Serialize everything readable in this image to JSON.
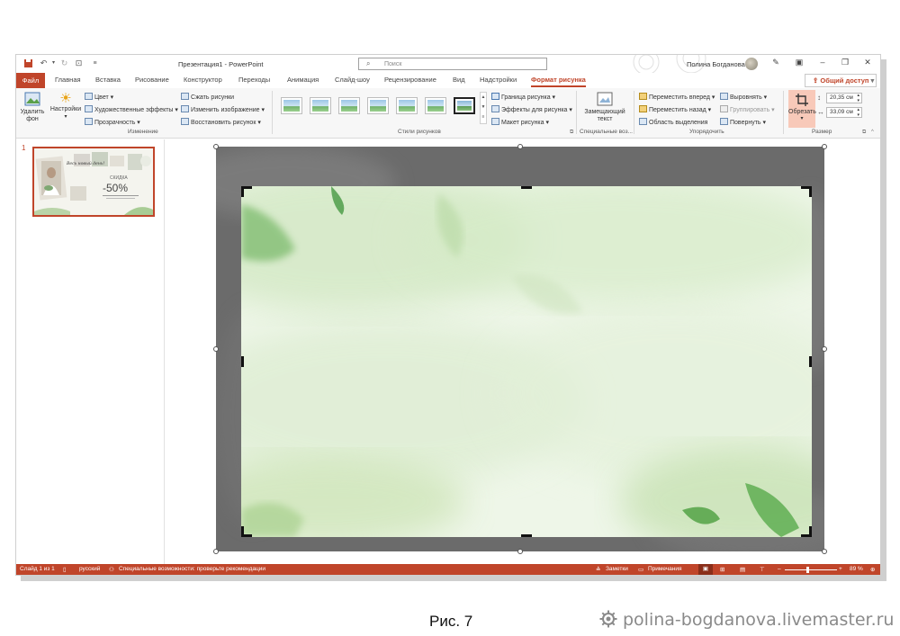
{
  "titlebar": {
    "doc_title": "Презентация1  -  PowerPoint",
    "search_placeholder": "Поиск",
    "user_name": "Полина Богданова"
  },
  "tabs": {
    "file": "Файл",
    "items": [
      "Главная",
      "Вставка",
      "Рисование",
      "Конструктор",
      "Переходы",
      "Анимация",
      "Слайд-шоу",
      "Рецензирование",
      "Вид",
      "Надстройки"
    ],
    "active": "Формат рисунка",
    "share": "Общий доступ"
  },
  "ribbon": {
    "remove_bg": "Удалить фон",
    "settings": "Настройки",
    "color": "Цвет",
    "artistic": "Художественные эффекты",
    "transparency": "Прозрачность",
    "compress": "Сжать рисунки",
    "change_picture": "Изменить изображение",
    "reset_picture": "Восстановить рисунок",
    "group_change": "Изменение",
    "group_styles": "Стили рисунков",
    "border": "Граница рисунка",
    "effects": "Эффекты для рисунка",
    "layout": "Макет рисунка",
    "alt_text": "Замещающий текст",
    "group_access": "Специальные воз...",
    "bring_forward": "Переместить вперед",
    "send_backward": "Переместить назад",
    "selection_pane": "Область выделения",
    "align": "Выровнять",
    "group": "Группировать",
    "rotate": "Повернуть",
    "group_arrange": "Упорядочить",
    "crop": "Обрезать",
    "height": "20,35 см",
    "width": "33,09 см",
    "group_size": "Размер"
  },
  "thumbnail": {
    "number": "1",
    "title_line": "Весь новый день!",
    "sale_word": "СКИДКА",
    "discount": "-50%"
  },
  "statusbar": {
    "slide": "Слайд 1 из 1",
    "language": "русский",
    "accessibility": "Специальные возможности: проверьте рекомендации",
    "notes": "Заметки",
    "comments": "Примечания",
    "zoom": "89 %"
  },
  "caption": "Рис. 7",
  "watermark": "polina-bogdanova.livemaster.ru",
  "colors": {
    "accent": "#c0452a",
    "crop_frame": "#6b6b6b",
    "image_bg": "#eef6e8"
  }
}
